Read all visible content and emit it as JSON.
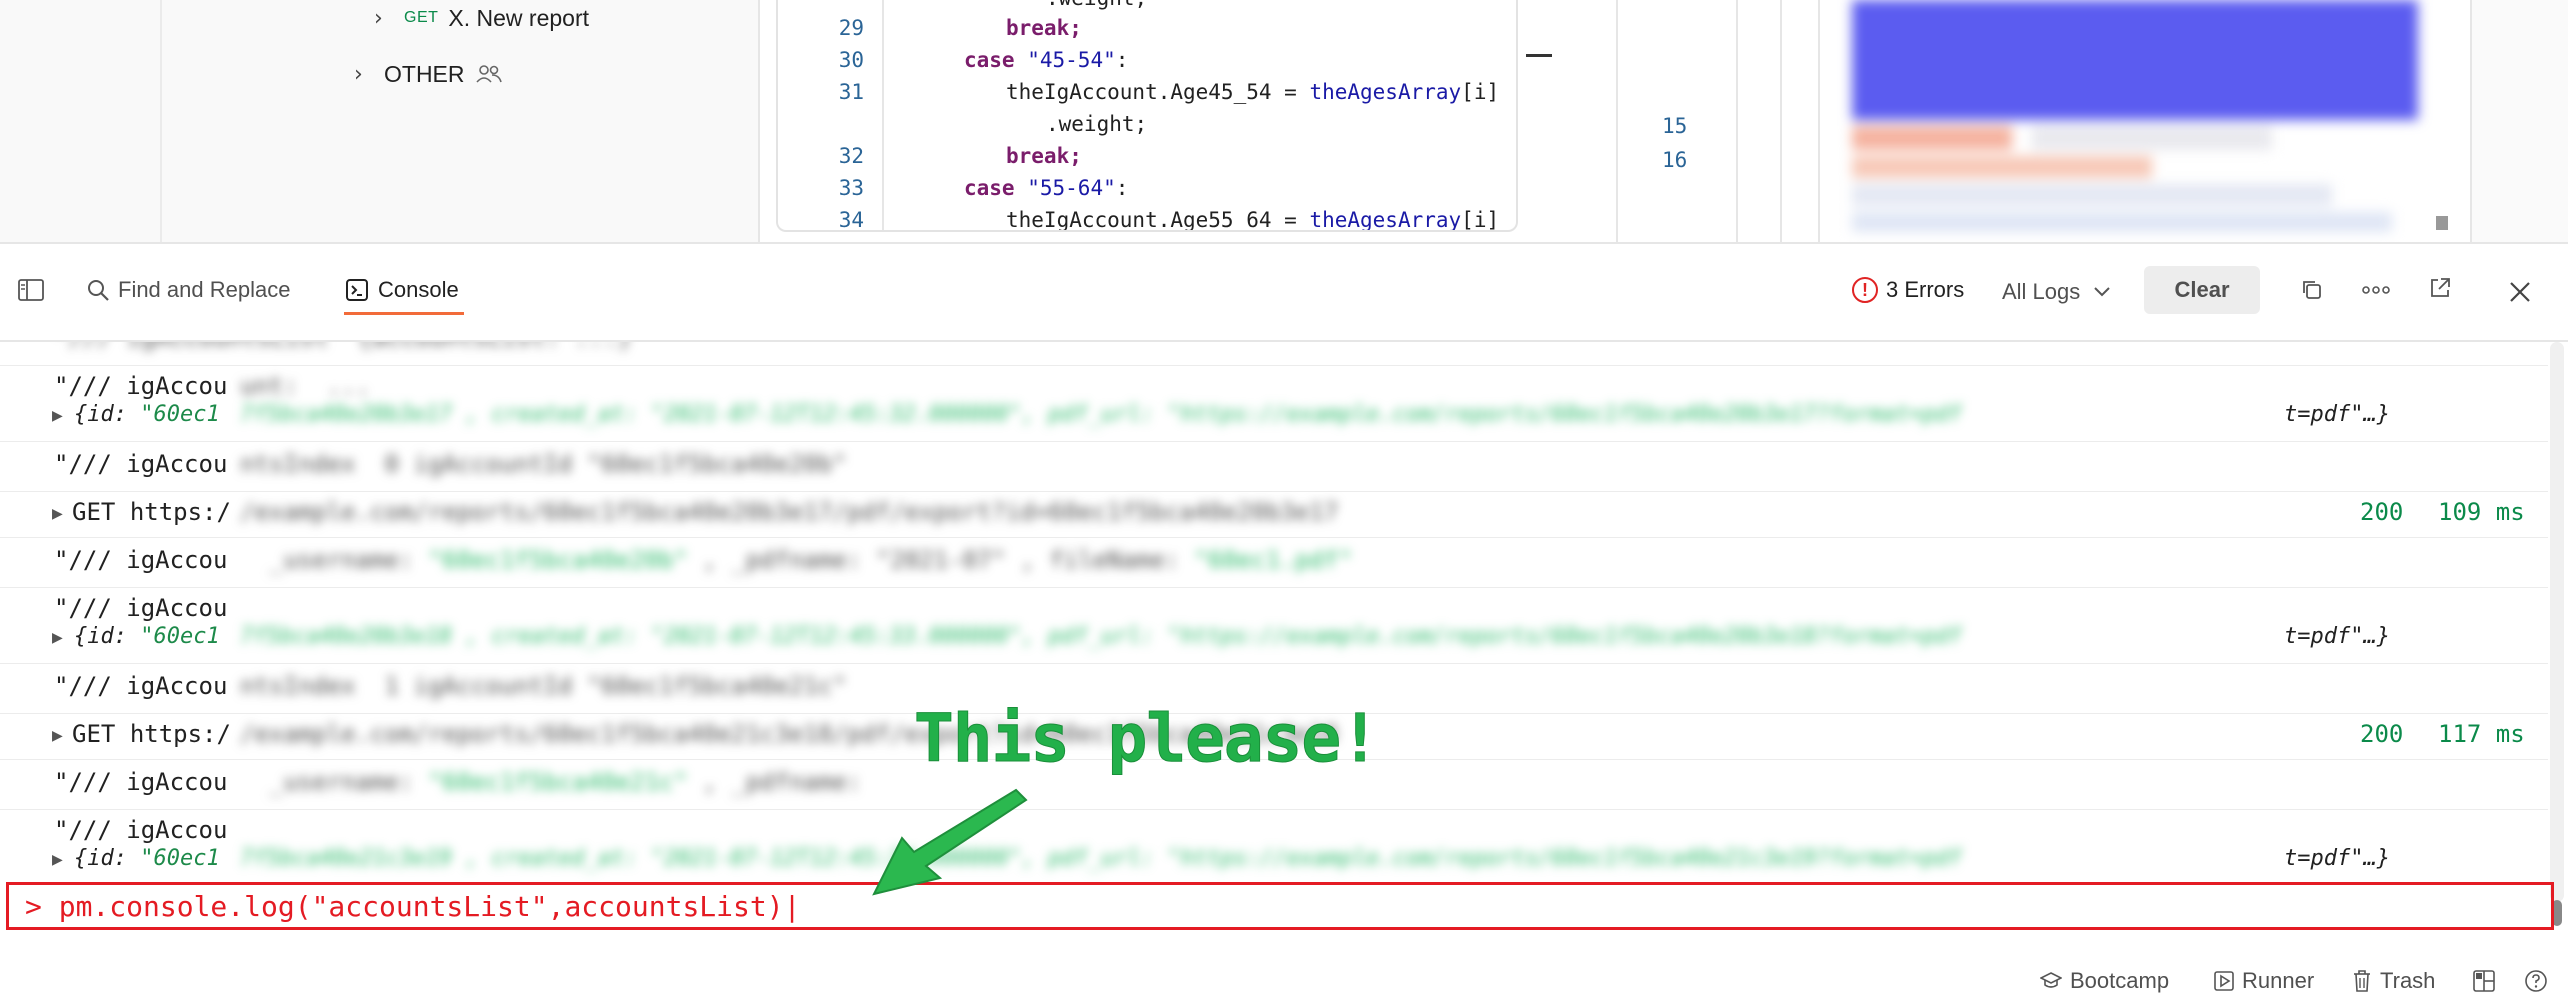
{
  "sidebar": {
    "items": [
      {
        "method": "GET",
        "label": "X. New report"
      },
      {
        "label": "OTHER"
      }
    ]
  },
  "editor": {
    "line_numbers": [
      "29",
      "30",
      "31",
      "32",
      "33",
      "34"
    ],
    "lines": {
      "l28_tail": ".weight;",
      "l29": "break;",
      "l30_kw": "case",
      "l30_str": "\"45-54\"",
      "l31_obj": "theIgAccount",
      "l31_prop": ".Age45_54",
      "l31_eq": " = ",
      "l31_arr": "theAgesArray",
      "l31_idx": "[i]",
      "l31_cont": ".weight;",
      "l32": "break;",
      "l33_kw": "case",
      "l33_str": "\"55-64\"",
      "l34_obj": "theIgAccount",
      "l34_prop": ".Age55_64",
      "l34_eq": " = ",
      "l34_arr": "theAgesArray",
      "l34_idx": "[i]"
    }
  },
  "response": {
    "line_numbers": [
      "15",
      "16"
    ]
  },
  "console_toolbar": {
    "find_replace": "Find and Replace",
    "console_tab": "Console",
    "errors": "3 Errors",
    "log_filter": "All Logs",
    "clear": "Clear"
  },
  "console_log": [
    {
      "type": "text",
      "text": "\"/// igAccou"
    },
    {
      "type": "object",
      "key": "{id: ",
      "value": "\"60ec1",
      "tail": "t=pdf\"…}"
    },
    {
      "type": "text",
      "text": "\"/// igAccou"
    },
    {
      "type": "request",
      "method": "GET",
      "url": "https:/",
      "status": "200",
      "time": "109 ms"
    },
    {
      "type": "text",
      "text": "\"/// igAccou"
    },
    {
      "type": "text",
      "text": "\"/// igAccou"
    },
    {
      "type": "object",
      "key": "{id: ",
      "value": "\"60ec1",
      "tail": "t=pdf\"…}"
    },
    {
      "type": "text",
      "text": "\"/// igAccou"
    },
    {
      "type": "request",
      "method": "GET",
      "url": "https:/",
      "status": "200",
      "time": "117 ms"
    },
    {
      "type": "text",
      "text": "\"/// igAccou"
    },
    {
      "type": "text",
      "text": "\"/// igAccou"
    },
    {
      "type": "object",
      "key": "{id: ",
      "value": "\"60ec1",
      "tail": "t=pdf\"…}"
    }
  ],
  "console_input": {
    "value": "> pm.console.log(\"accountsList\",accountsList)|"
  },
  "annotation": {
    "text": "This please!",
    "color": "#22b04a"
  },
  "status_bar": {
    "bootcamp": "Bootcamp",
    "runner": "Runner",
    "trash": "Trash"
  },
  "colors": {
    "accent_tab": "#f26b3a",
    "error": "#e02424",
    "success": "#0b8a4a",
    "highlight_box": "#e41b23"
  }
}
